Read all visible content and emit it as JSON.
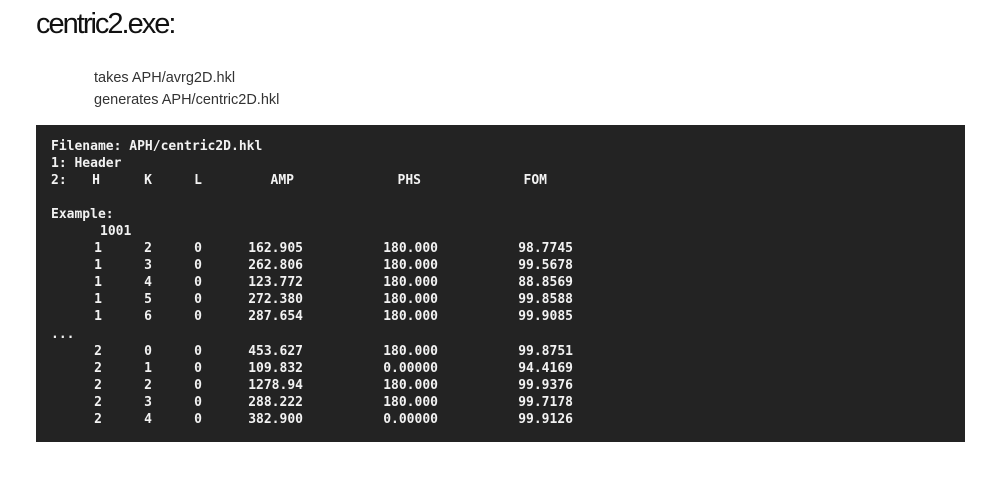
{
  "page": {
    "title": "centric2.exe:",
    "description": [
      "takes APH/avrg2D.hkl",
      "generates APH/centric2D.hkl"
    ]
  },
  "code": {
    "filename_line": "Filename: APH/centric2D.hkl",
    "header_line": "1: Header",
    "columns_prefix": "2:",
    "columns": [
      "H",
      "K",
      "L",
      "AMP",
      "PHS",
      "FOM"
    ],
    "example_label": "Example:",
    "count": "1001",
    "ellipsis": "...",
    "rows_a": [
      [
        "1",
        "2",
        "0",
        "162.905",
        "180.000",
        "98.7745"
      ],
      [
        "1",
        "3",
        "0",
        "262.806",
        "180.000",
        "99.5678"
      ],
      [
        "1",
        "4",
        "0",
        "123.772",
        "180.000",
        "88.8569"
      ],
      [
        "1",
        "5",
        "0",
        "272.380",
        "180.000",
        "99.8588"
      ],
      [
        "1",
        "6",
        "0",
        "287.654",
        "180.000",
        "99.9085"
      ]
    ],
    "rows_b": [
      [
        "2",
        "0",
        "0",
        "453.627",
        "180.000",
        "99.8751"
      ],
      [
        "2",
        "1",
        "0",
        "109.832",
        "0.00000",
        "94.4169"
      ],
      [
        "2",
        "2",
        "0",
        "1278.94",
        "180.000",
        "99.9376"
      ],
      [
        "2",
        "3",
        "0",
        "288.222",
        "180.000",
        "99.7178"
      ],
      [
        "2",
        "4",
        "0",
        "382.900",
        "0.00000",
        "99.9126"
      ]
    ]
  }
}
